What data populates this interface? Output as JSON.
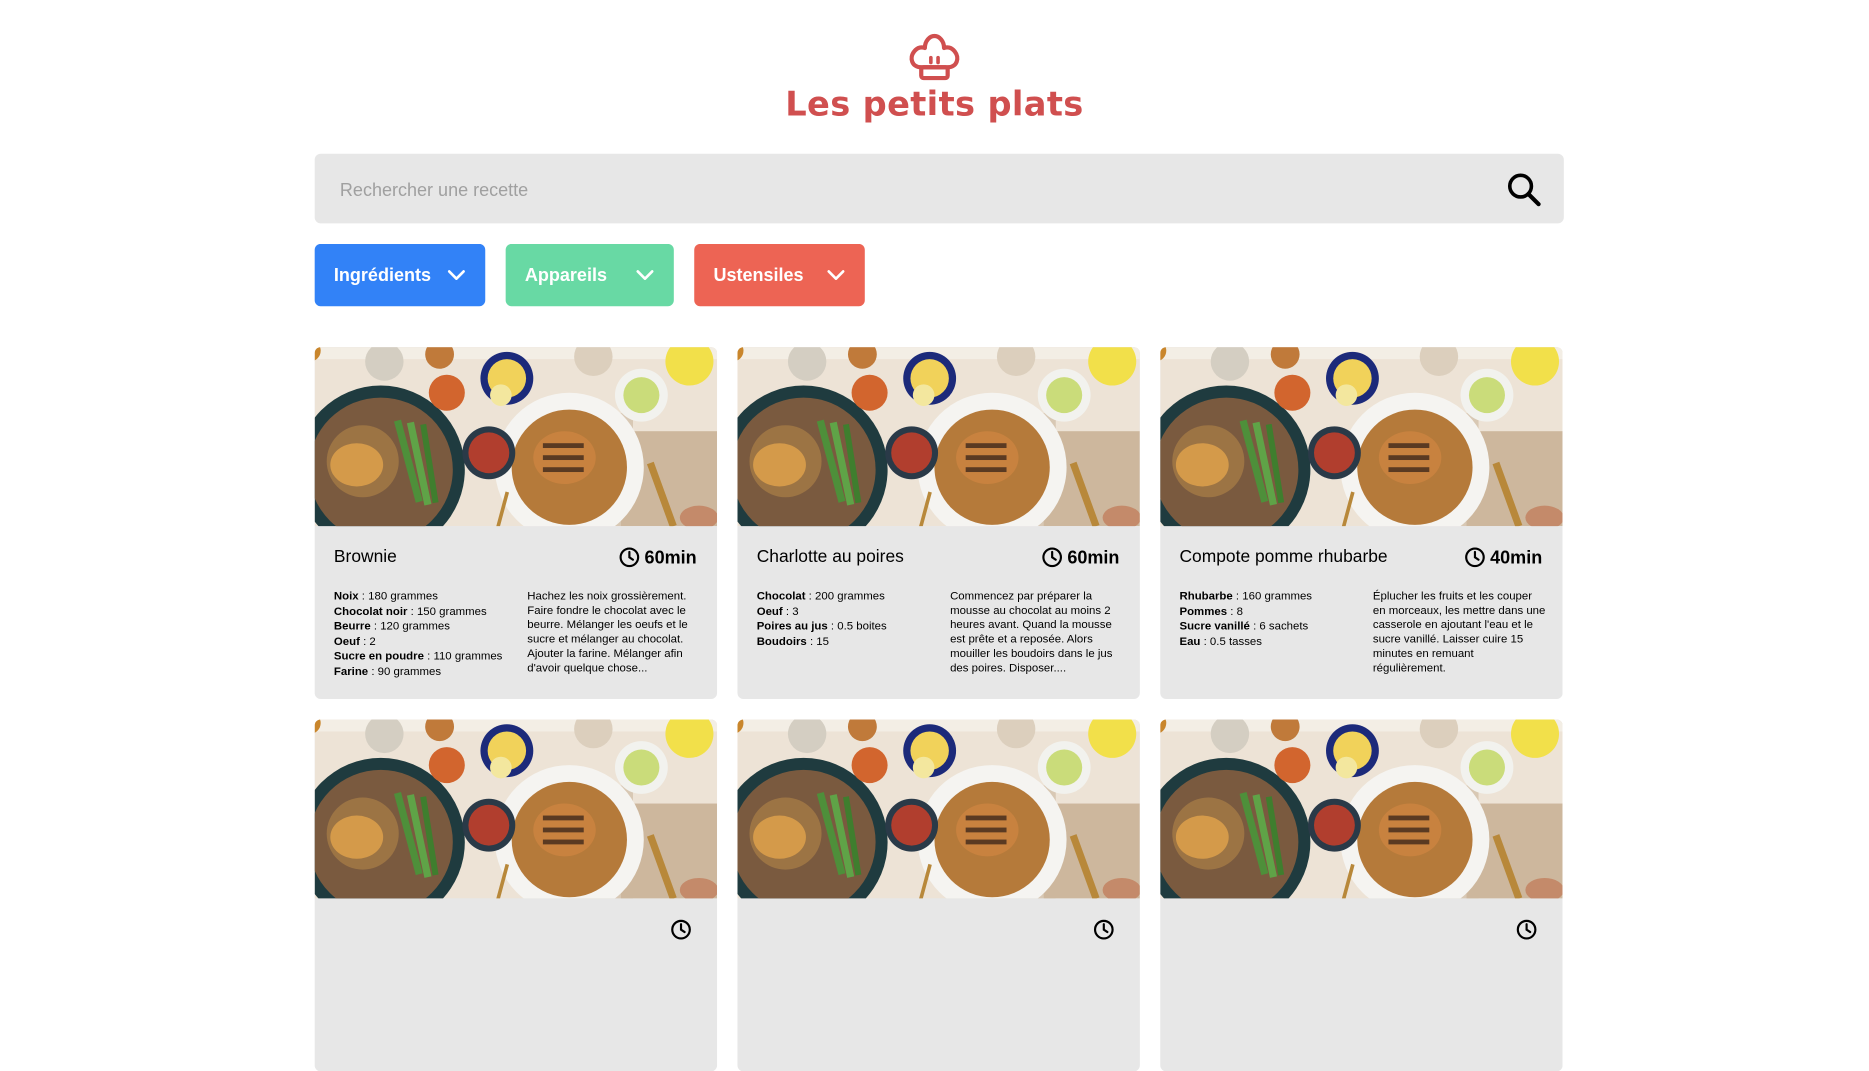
{
  "header": {
    "logo_icon": "chef-hat-icon",
    "title": "Les petits plats",
    "brand_color": "#D04F4F"
  },
  "search": {
    "placeholder": "Rechercher une recette",
    "value": "",
    "icon": "search-icon"
  },
  "filters": [
    {
      "label": "Ingrédients",
      "color": "#3282F7",
      "icon": "chevron-down-icon"
    },
    {
      "label": "Appareils",
      "color": "#68D9A4",
      "icon": "chevron-down-icon"
    },
    {
      "label": "Ustensiles",
      "color": "#ED6454",
      "icon": "chevron-down-icon"
    }
  ],
  "recipes": [
    {
      "name": "Brownie",
      "time": "60min",
      "ingredients": [
        {
          "name": "Noix",
          "qty": " : 180 grammes"
        },
        {
          "name": "Chocolat noir",
          "qty": " : 150 grammes"
        },
        {
          "name": "Beurre",
          "qty": " : 120 grammes"
        },
        {
          "name": "Oeuf",
          "qty": " : 2"
        },
        {
          "name": "Sucre en poudre",
          "qty": " : 110 grammes"
        },
        {
          "name": "Farine",
          "qty": " : 90 grammes"
        }
      ],
      "description": "Hachez les noix grossièrement. Faire fondre le chocolat avec le beurre. Mélanger les oeufs et le sucre et mélanger au chocolat. Ajouter la farine. Mélanger afin d'avoir quelque chose..."
    },
    {
      "name": "Charlotte au poires",
      "time": "60min",
      "ingredients": [
        {
          "name": "Chocolat",
          "qty": " : 200 grammes"
        },
        {
          "name": "Oeuf",
          "qty": " : 3"
        },
        {
          "name": "Poires au jus",
          "qty": " : 0.5 boites"
        },
        {
          "name": "Boudoirs",
          "qty": " : 15"
        }
      ],
      "description": "Commencez par préparer la mousse au chocolat au moins 2 heures avant. Quand la mousse est prête et a reposée. Alors mouiller les boudoirs dans le jus des poires. Disposer...."
    },
    {
      "name": "Compote pomme rhubarbe",
      "time": "40min",
      "ingredients": [
        {
          "name": "Rhubarbe",
          "qty": " : 160 grammes"
        },
        {
          "name": "Pommes",
          "qty": " : 8"
        },
        {
          "name": "Sucre vanillé",
          "qty": " : 6 sachets"
        },
        {
          "name": "Eau",
          "qty": " : 0.5 tasses"
        }
      ],
      "description": "Éplucher les fruits et les couper en morceaux, les mettre dans une casserole en ajoutant l'eau et le sucre vanillé. Laisser cuire 15 minutes en remuant régulièrement."
    },
    {
      "name": "",
      "time": "",
      "ingredients": [],
      "description": ""
    },
    {
      "name": "",
      "time": "",
      "ingredients": [],
      "description": ""
    },
    {
      "name": "",
      "time": "",
      "ingredients": [],
      "description": ""
    }
  ]
}
